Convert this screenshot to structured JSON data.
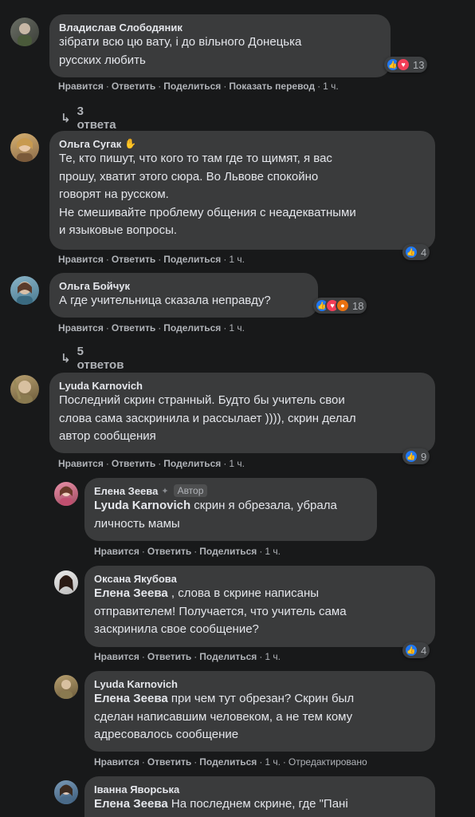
{
  "colors": {
    "background": "#18191a",
    "bubble": "#3a3b3c",
    "text": "#e4e6eb",
    "secondary": "#b0b3b8",
    "like": "#2078f4",
    "love": "#f33e58",
    "angry": "#e9710f"
  },
  "actions": {
    "like": "Нравится",
    "reply": "Ответить",
    "share": "Поделиться",
    "translate": "Показать перевод",
    "sep": "·"
  },
  "comments": [
    {
      "author": "Владислав Слободяник",
      "text_lines": [
        "зібрати всю цю вату, і до вільного Донецька",
        "русских любить"
      ],
      "reactions": [
        "like-icon",
        "love-icon"
      ],
      "reaction_count": "13",
      "time": "1 ч.",
      "replies_label": "3 ответа"
    },
    {
      "author": "Ольга Сугак",
      "text_lines": [
        "Те, кто пишут, что кого то там где то щимят, я вас",
        "прошу, хватит этого сюра. Во Львове спокойно",
        "говорят на русском.",
        "Не смешивайте проблему общения с неадекватными",
        "и языковые вопросы."
      ],
      "reaction_count": "4",
      "time": "1 ч."
    },
    {
      "author": "Ольга Бойчук",
      "text_lines": [
        "А где учительница сказала неправду?"
      ],
      "reaction_count": "18",
      "time": "1 ч.",
      "replies_label": "5 ответов"
    },
    {
      "author": "Lyuda Karnovich",
      "text_lines": [
        "Последний скрин странный. Будто бы учитель свои",
        "слова сама заскринила и рассылает )))), скрин делал",
        "автор сообщения"
      ],
      "reaction_count": "9",
      "time": "1 ч."
    }
  ],
  "replies": [
    {
      "author": "Елена Зеева",
      "badge": "Автор",
      "mention": "Lyuda Karnovich",
      "line1_rest": " скрин я обрезала, убрала",
      "more_lines": [
        "личность мамы"
      ],
      "time": "1 ч."
    },
    {
      "author": "Оксана Якубова",
      "mention": "Елена Зеева",
      "line1_rest": " , слова в скрине написаны",
      "more_lines": [
        "отправителем! Получается, что учитель сама",
        "заскринила свое сообщение?"
      ],
      "reaction_count": "4",
      "time": "1 ч."
    },
    {
      "author": "Lyuda Karnovich",
      "mention": "Елена Зеева",
      "line1_rest": " при чем тут обрезан? Скрин был",
      "more_lines": [
        "сделан написавшим человеком, а не тем кому",
        "адресовалось сообщение"
      ],
      "time": "1 ч.",
      "edited": "Отредактировано"
    },
    {
      "author": "Іванна Яворська",
      "mention": "Елена Зеева",
      "line1_rest": " На последнем скрине, где \"Пані",
      "time": ""
    }
  ]
}
